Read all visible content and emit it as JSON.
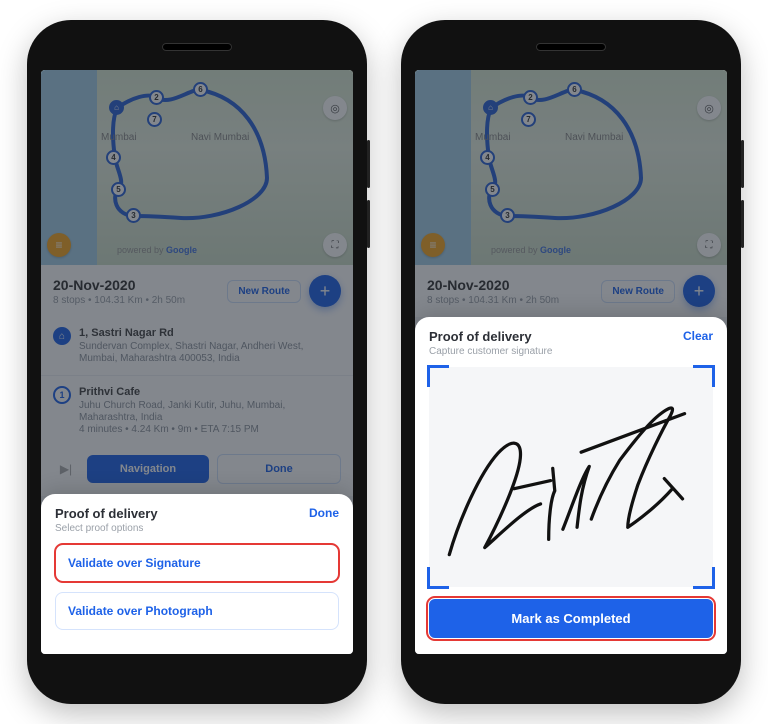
{
  "map": {
    "city_mumbai": "Mumbai",
    "city_navi": "Navi Mumbai",
    "credit_prefix": "powered by",
    "credit_brand": "Google",
    "markers": [
      "2",
      "7",
      "4",
      "5",
      "3",
      "6"
    ],
    "chip_sales_icon": "sales-chart-icon",
    "chip_full_icon": "fullscreen-icon",
    "chip_gps_icon": "gps-icon"
  },
  "date_card": {
    "title": "20-Nov-2020",
    "subline": "8 stops • 104.31 Km • 2h 50m",
    "new_route": "New Route",
    "fab_icon": "plus-icon"
  },
  "stops": [
    {
      "bullet": "home",
      "addr": "1, Sastri Nagar Rd",
      "line1": "Sundervan Complex, Shastri Nagar, Andheri West,",
      "line2": "Mumbai, Maharashtra 400053, India"
    },
    {
      "bullet": "1",
      "addr": "Prithvi Cafe",
      "line1": "Juhu Church Road, Janki Kutir, Juhu, Mumbai,",
      "line2": "Maharashtra, India",
      "meta": "4 minutes • 4.24 Km • 9m • ETA 7:15 PM"
    }
  ],
  "nav_row": {
    "step_icon": "step-forward-icon",
    "navigation": "Navigation",
    "done": "Done"
  },
  "sheet_left": {
    "title": "Proof of delivery",
    "subtitle": "Select proof options",
    "action": "Done",
    "opt_sig": "Validate over Signature",
    "opt_photo": "Validate over Photograph"
  },
  "sheet_right": {
    "title": "Proof of delivery",
    "subtitle": "Capture customer signature",
    "action": "Clear",
    "complete": "Mark as Completed"
  }
}
